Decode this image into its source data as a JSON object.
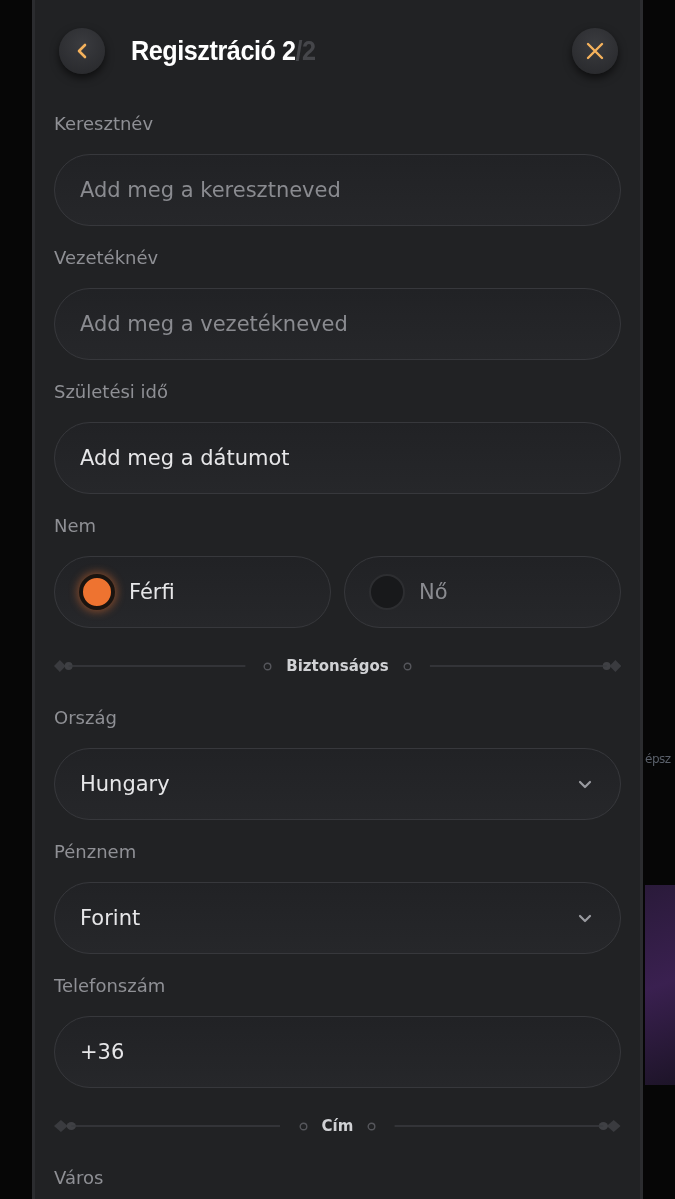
{
  "background_page": {
    "text_fragment": "épsz"
  },
  "modal": {
    "title": "Regisztráció 2",
    "title_suffix": "/2"
  },
  "sections": [
    {
      "kind": "text_field",
      "label": "Keresztnév",
      "placeholder": "Add meg a keresztneved"
    },
    {
      "kind": "text_field",
      "label": "Vezetéknév",
      "placeholder": "Add meg a vezetékneved"
    },
    {
      "kind": "date_field",
      "label": "Születési idő",
      "value": "Add meg a dátumot"
    },
    {
      "kind": "radio",
      "label": "Nem",
      "options": [
        {
          "label": "Férfi",
          "selected": true
        },
        {
          "label": "Nő",
          "selected": false
        }
      ]
    },
    {
      "kind": "divider",
      "label": "Biztonságos"
    },
    {
      "kind": "select_field",
      "label": "Ország",
      "value": "Hungary"
    },
    {
      "kind": "select_field",
      "label": "Pénznem",
      "value": "Forint"
    },
    {
      "kind": "text_field",
      "label": "Telefonszám",
      "value": "+36"
    },
    {
      "kind": "divider",
      "label": "Cím"
    },
    {
      "kind": "label",
      "label": "Város"
    }
  ]
}
